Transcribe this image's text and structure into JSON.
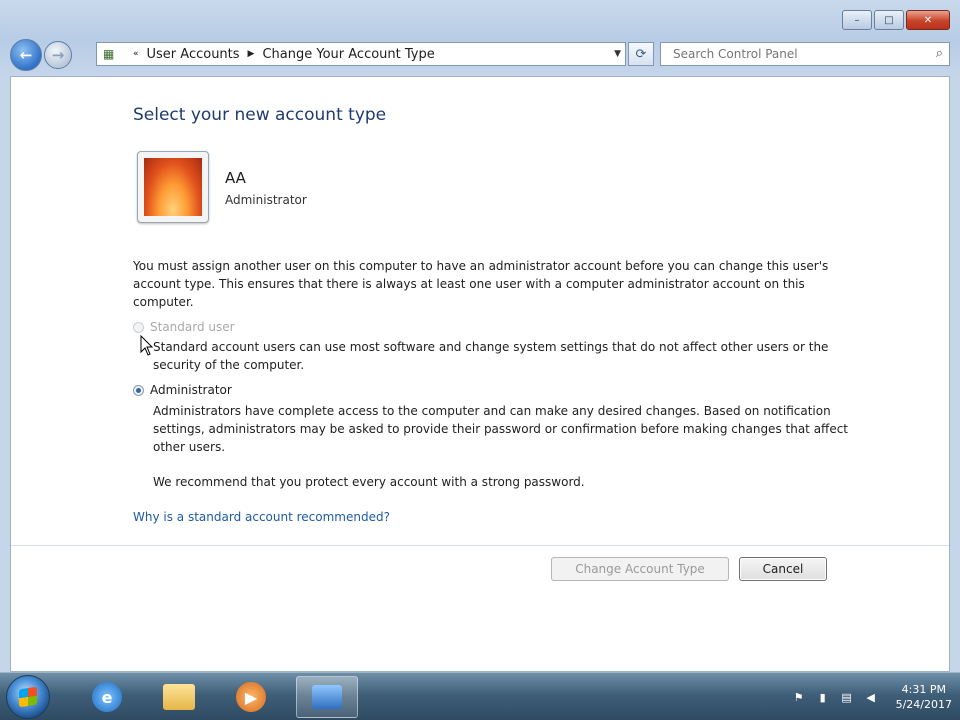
{
  "window": {
    "caption": {
      "minimize": "–",
      "maximize": "□",
      "close": "✕"
    }
  },
  "nav": {
    "breadcrumbs": [
      "User Accounts",
      "Change Your Account Type"
    ],
    "search_placeholder": "Search Control Panel"
  },
  "main": {
    "title": "Select your new account type",
    "user": {
      "name": "AA",
      "type": "Administrator"
    },
    "notice": "You must assign another user on this computer to have an administrator account before you can change this user's account type. This ensures that there is always at least one user with a computer administrator account on this computer.",
    "options": [
      {
        "label": "Standard user",
        "description": "Standard account users can use most software and change system settings that do not affect other users or the security of the computer.",
        "selected": false,
        "disabled": true
      },
      {
        "label": "Administrator",
        "description": "Administrators have complete access to the computer and can make any desired changes. Based on notification settings, administrators may be asked to provide their password or confirmation before making changes that affect other users.",
        "selected": true,
        "disabled": false
      }
    ],
    "recommendation": "We recommend that you protect every account with a strong password.",
    "help_link": "Why is a standard account recommended?",
    "buttons": {
      "change": "Change Account Type",
      "cancel": "Cancel"
    }
  },
  "taskbar": {
    "clock_time": "4:31 PM",
    "clock_date": "5/24/2017"
  },
  "colors": {
    "title": "#1e3b6e",
    "link": "#1e5ba6",
    "taskbar": "#3f5e78"
  }
}
